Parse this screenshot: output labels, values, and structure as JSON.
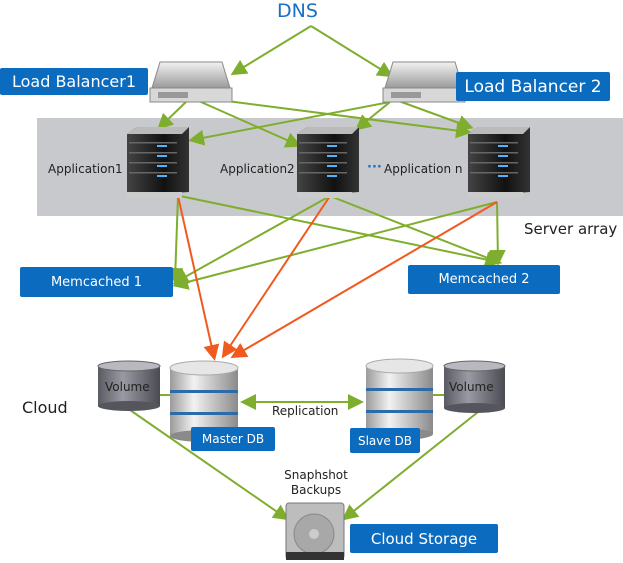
{
  "title": "DNS",
  "load_balancers": [
    "Load Balancer1",
    "Load Balancer 2"
  ],
  "server_array": {
    "label": "Server array",
    "apps": [
      "Application1",
      "Application2",
      "Application  n"
    ],
    "ellipsis": "···"
  },
  "memcached": [
    "Memcached 1",
    "Memcached 2"
  ],
  "cloud": {
    "label": "Cloud",
    "volume_left": "Volume",
    "volume_right": "Volume",
    "master": "Master DB",
    "slave": "Slave DB",
    "replication": "Replication",
    "snapshot_line1": "Snaphshot",
    "snapshot_line2": "Backups",
    "storage": "Cloud Storage"
  },
  "colors": {
    "accent": "#0b6bbf",
    "dns": "#1a6fc4",
    "link": "#7fae2e",
    "db_link": "#f05a1e",
    "band": "#c8c9cd"
  }
}
